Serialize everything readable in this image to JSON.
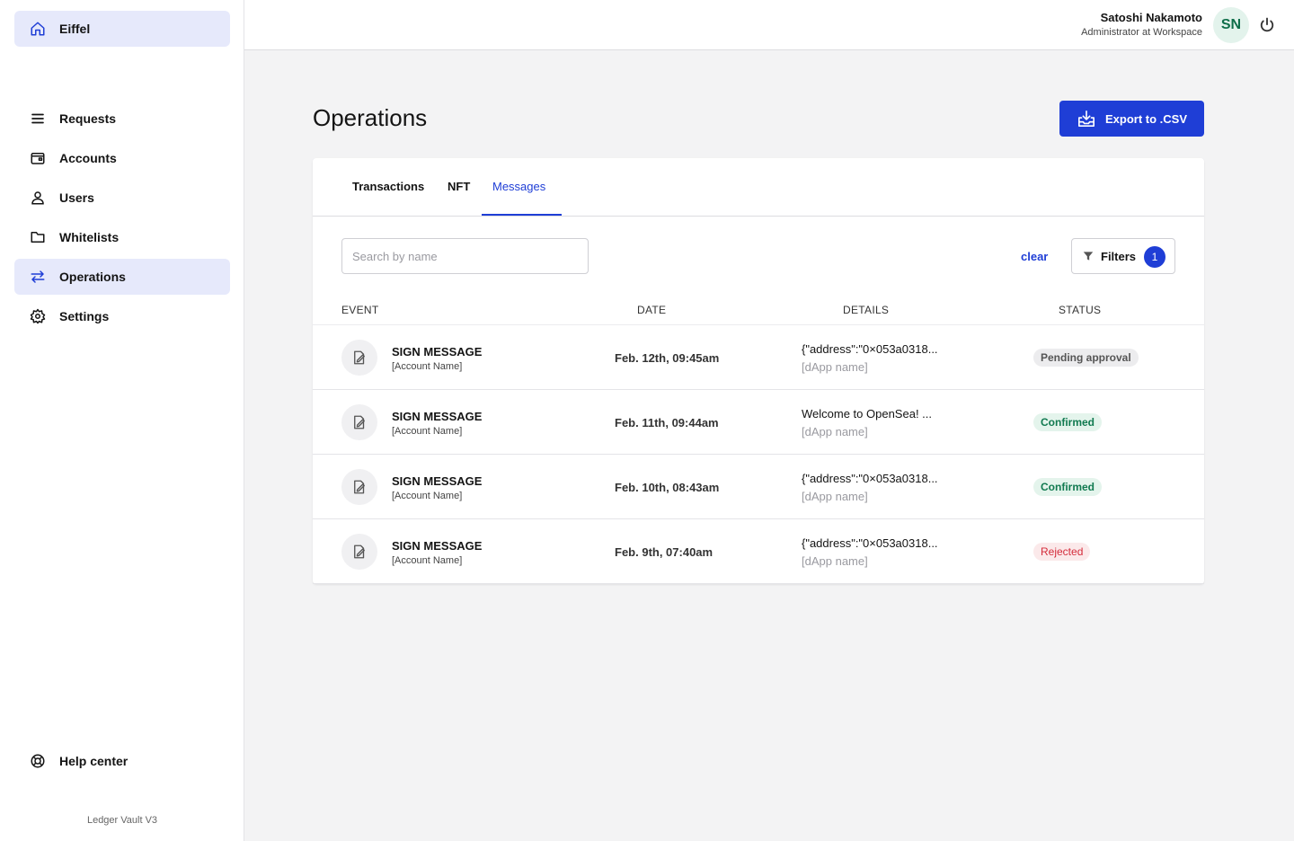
{
  "sidebar": {
    "brand": {
      "label": "Eiffel",
      "icon": "home-icon"
    },
    "items": [
      {
        "label": "Requests",
        "icon": "list-icon"
      },
      {
        "label": "Accounts",
        "icon": "wallet-icon"
      },
      {
        "label": "Users",
        "icon": "user-icon"
      },
      {
        "label": "Whitelists",
        "icon": "folder-icon"
      },
      {
        "label": "Operations",
        "icon": "arrows-swap-icon",
        "active": true
      },
      {
        "label": "Settings",
        "icon": "gear-icon"
      }
    ],
    "help": {
      "label": "Help center",
      "icon": "lifebuoy-icon"
    },
    "version": "Ledger Vault V3"
  },
  "header": {
    "user_name": "Satoshi Nakamoto",
    "user_role": "Administrator at Workspace",
    "avatar_initials": "SN",
    "power_icon": "power-icon"
  },
  "page": {
    "title": "Operations",
    "export_label": "Export to .CSV"
  },
  "tabs": [
    {
      "label": "Transactions"
    },
    {
      "label": "NFT"
    },
    {
      "label": "Messages",
      "active": true
    }
  ],
  "search": {
    "placeholder": "Search by name",
    "value": ""
  },
  "filters": {
    "clear_label": "clear",
    "label": "Filters",
    "count": "1"
  },
  "table": {
    "columns": [
      "EVENT",
      "DATE",
      "DETAILS",
      "STATUS"
    ],
    "rows": [
      {
        "event": "SIGN MESSAGE",
        "account": "[Account Name]",
        "date": "Feb. 12th, 09:45am",
        "details": "{\"address\":\"0×053a0318...",
        "dapp": "[dApp name]",
        "status": "Pending approval",
        "status_type": "pending"
      },
      {
        "event": "SIGN MESSAGE",
        "account": "[Account Name]",
        "date": "Feb. 11th, 09:44am",
        "details": "Welcome to OpenSea! ...",
        "dapp": "[dApp name]",
        "status": "Confirmed",
        "status_type": "confirmed"
      },
      {
        "event": "SIGN MESSAGE",
        "account": "[Account Name]",
        "date": "Feb. 10th, 08:43am",
        "details": "{\"address\":\"0×053a0318...",
        "dapp": "[dApp name]",
        "status": "Confirmed",
        "status_type": "confirmed"
      },
      {
        "event": "SIGN MESSAGE",
        "account": "[Account Name]",
        "date": "Feb. 9th, 07:40am",
        "details": "{\"address\":\"0×053a0318...",
        "dapp": "[dApp name]",
        "status": "Rejected",
        "status_type": "rejected"
      }
    ]
  },
  "colors": {
    "accent": "#1f3ed6",
    "active_bg": "#e6e9fb",
    "confirmed": "#117a50",
    "rejected": "#d42b3a"
  }
}
